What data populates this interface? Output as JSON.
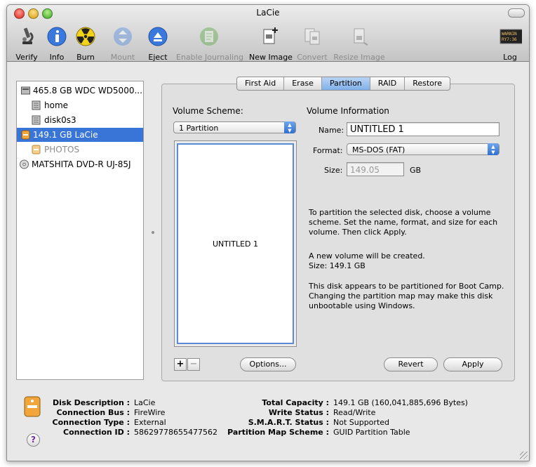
{
  "window": {
    "title": "LaCie"
  },
  "toolbar": {
    "verify": "Verify",
    "info": "Info",
    "burn": "Burn",
    "mount": "Mount",
    "eject": "Eject",
    "enable_journaling": "Enable Journaling",
    "new_image": "New Image",
    "convert": "Convert",
    "resize_image": "Resize Image",
    "log": "Log",
    "log_icon_text_1": "WARNIN",
    "log_icon_text_2": "RY7:36"
  },
  "sidebar": {
    "items": [
      {
        "label": "465.8 GB WDC WD5000...",
        "icon": "hard-disk-icon"
      },
      {
        "label": "home",
        "icon": "volume-icon"
      },
      {
        "label": "disk0s3",
        "icon": "volume-icon"
      },
      {
        "label": "149.1 GB LaCie",
        "icon": "external-disk-icon",
        "selected": true
      },
      {
        "label": "PHOTOS",
        "icon": "external-volume-icon",
        "dimmed": true
      },
      {
        "label": "MATSHITA DVD-R UJ-85J",
        "icon": "optical-drive-icon"
      }
    ]
  },
  "tabs": [
    "First Aid",
    "Erase",
    "Partition",
    "RAID",
    "Restore"
  ],
  "partition": {
    "volume_scheme_label": "Volume Scheme:",
    "volume_scheme_value": "1 Partition",
    "volume_info_label": "Volume Information",
    "name_label": "Name:",
    "name_value": "UNTITLED 1",
    "format_label": "Format:",
    "format_value": "MS-DOS (FAT)",
    "size_label": "Size:",
    "size_value": "149.05",
    "size_unit": "GB",
    "partition_name": "UNTITLED 1",
    "add": "+",
    "remove": "−",
    "options_button": "Options...",
    "revert_button": "Revert",
    "apply_button": "Apply",
    "info_text_1": "To partition the selected disk, choose a volume scheme. Set the name, format, and size for each volume. Then click Apply.",
    "info_text_2a": "A new volume will be created.",
    "info_text_2b": "Size: 149.1 GB",
    "info_text_3": "This disk appears to be partitioned for Boot Camp. Changing the partition map may make this disk unbootable using Windows."
  },
  "details": {
    "left": [
      {
        "key": "Disk Description :",
        "value": "LaCie"
      },
      {
        "key": "Connection Bus :",
        "value": "FireWire"
      },
      {
        "key": "Connection Type :",
        "value": "External"
      },
      {
        "key": "Connection ID :",
        "value": "58629778655477562"
      }
    ],
    "right": [
      {
        "key": "Total Capacity :",
        "value": "149.1 GB (160,041,885,696 Bytes)"
      },
      {
        "key": "Write Status :",
        "value": "Read/Write"
      },
      {
        "key": "S.M.A.R.T. Status :",
        "value": "Not Supported"
      },
      {
        "key": "Partition Map Scheme :",
        "value": "GUID Partition Table"
      }
    ],
    "help": "?"
  },
  "colors": {
    "selection": "#3875d7",
    "accent_blue": "#2f6ed2",
    "partition_border": "#5d8ad6"
  }
}
